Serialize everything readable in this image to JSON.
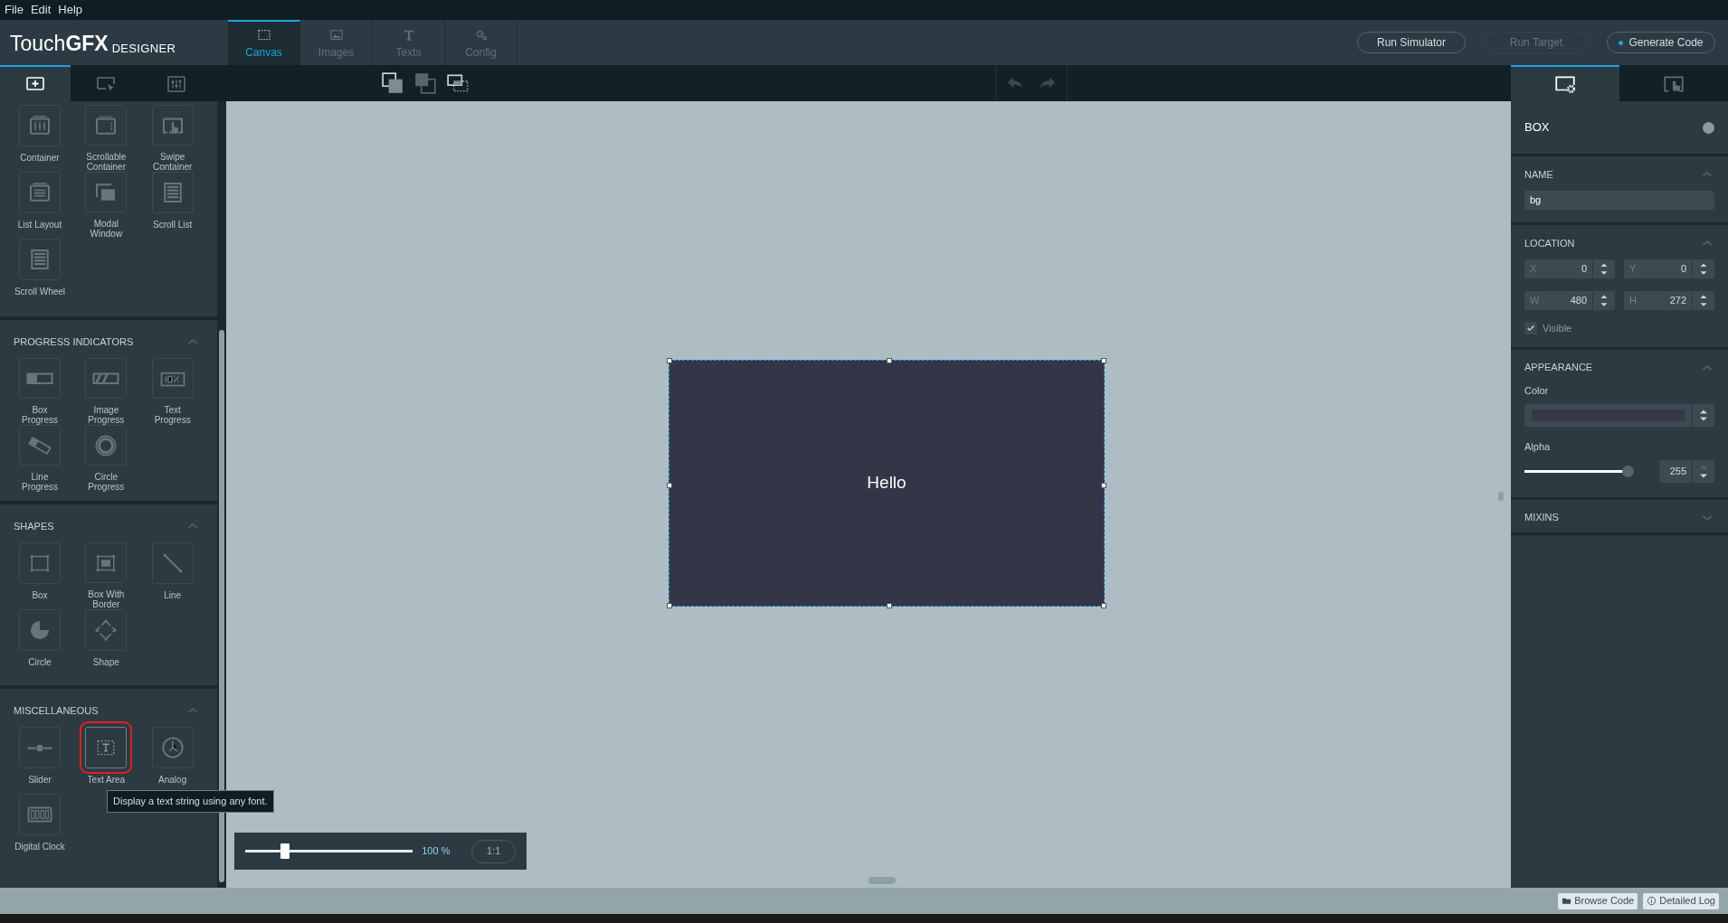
{
  "menu": [
    "File",
    "Edit",
    "Help"
  ],
  "logo": {
    "brand": "Touch**GFX**",
    "suffix": "DESIGNER"
  },
  "main_tabs": [
    {
      "label": "Canvas",
      "kind": "canvas",
      "selected": true
    },
    {
      "label": "Images",
      "kind": "image",
      "selected": false
    },
    {
      "label": "Texts",
      "kind": "text",
      "selected": false
    },
    {
      "label": "Config",
      "kind": "gears",
      "selected": false
    }
  ],
  "actions": [
    {
      "label": "Run Simulator",
      "disabled": false,
      "dot": false
    },
    {
      "label": "Run Target",
      "disabled": true,
      "dot": false
    },
    {
      "label": "Generate Code",
      "disabled": false,
      "dot": true
    }
  ],
  "left_tabs": [
    {
      "kind": "add",
      "selected": true
    },
    {
      "kind": "select",
      "selected": false
    },
    {
      "kind": "sliders",
      "selected": false
    }
  ],
  "widget_groups": [
    {
      "items": [
        {
          "label": "Container",
          "kind": "container",
          "highlighted": false
        },
        {
          "label": "Scrollable Container",
          "kind": "scrollable",
          "highlighted": false
        },
        {
          "label": "Swipe Container",
          "kind": "swipe",
          "highlighted": false
        },
        {
          "label": "List Layout",
          "kind": "list",
          "highlighted": false
        },
        {
          "label": "Modal Window",
          "kind": "modal",
          "highlighted": false
        },
        {
          "label": "Scroll List",
          "kind": "lines",
          "highlighted": false
        },
        {
          "label": "Scroll Wheel",
          "kind": "lines",
          "highlighted": false
        }
      ]
    },
    {
      "title": "PROGRESS INDICATORS",
      "items": [
        {
          "label": "Box Progress",
          "kind": "boxprogress",
          "highlighted": false
        },
        {
          "label": "Image Progress",
          "kind": "imageprogress",
          "highlighted": false
        },
        {
          "label": "Text Progress",
          "kind": "textprogress",
          "highlighted": false
        },
        {
          "label": "Line Progress",
          "kind": "lineprogress",
          "highlighted": false
        },
        {
          "label": "Circle Progress",
          "kind": "ring",
          "highlighted": false
        }
      ]
    },
    {
      "title": "SHAPES",
      "items": [
        {
          "label": "Box",
          "kind": "box",
          "highlighted": false
        },
        {
          "label": "Box With Border",
          "kind": "boxborder",
          "highlighted": false
        },
        {
          "label": "Line",
          "kind": "line",
          "highlighted": false
        },
        {
          "label": "Circle",
          "kind": "pie",
          "highlighted": false
        },
        {
          "label": "Shape",
          "kind": "diamond",
          "highlighted": false
        }
      ]
    },
    {
      "title": "MISCELLANEOUS",
      "items": [
        {
          "label": "Slider",
          "kind": "slider",
          "highlighted": false
        },
        {
          "label": "Text Area",
          "kind": "textarea",
          "highlighted": true
        },
        {
          "label": "Analog",
          "kind": "clock",
          "highlighted": false
        },
        {
          "label": "Digital Clock",
          "kind": "digital",
          "highlighted": false
        }
      ]
    }
  ],
  "tooltip": "Display a text string using any font.",
  "canvas": {
    "text": "Hello"
  },
  "zoom": {
    "level": 0.24,
    "reading": "100 %",
    "reset": "1:1"
  },
  "right_tabs": [
    {
      "kind": "properties",
      "selected": true
    },
    {
      "kind": "interactions",
      "selected": false
    }
  ],
  "properties": {
    "title": "BOX",
    "name": {
      "title": "NAME",
      "expanded": true,
      "value": "bg"
    },
    "location": {
      "title": "LOCATION",
      "expanded": true,
      "fields": [
        {
          "label": "X",
          "value": "0"
        },
        {
          "label": "Y",
          "value": "0"
        },
        {
          "label": "W",
          "value": "480"
        },
        {
          "label": "H",
          "value": "272"
        }
      ],
      "visible": {
        "label": "Visible",
        "checked": true
      }
    },
    "appearance": {
      "title": "APPEARANCE",
      "expanded": true,
      "color_label": "Color",
      "color": "#363848",
      "alpha_label": "Alpha",
      "alpha": {
        "level": 0.95,
        "value": "255"
      }
    },
    "mixins": {
      "title": "MIXINS",
      "expanded": false
    }
  },
  "bottom_buttons": [
    {
      "label": "Browse Code",
      "kind": "folder"
    },
    {
      "label": "Detailed Log",
      "kind": "info"
    }
  ]
}
